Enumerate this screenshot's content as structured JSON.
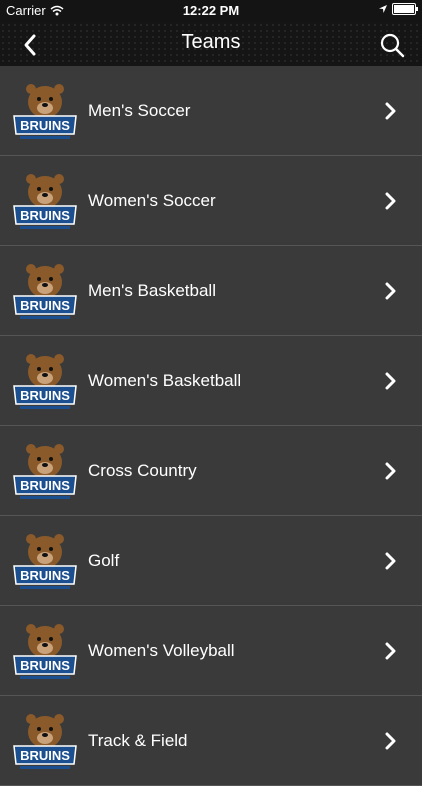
{
  "status_bar": {
    "carrier": "Carrier",
    "time": "12:22 PM"
  },
  "nav": {
    "title": "Teams",
    "back_icon": "back-chevron-icon",
    "search_icon": "search-icon"
  },
  "teams": [
    {
      "label": "Men's Soccer",
      "logo_text": "BRUINS"
    },
    {
      "label": "Women's Soccer",
      "logo_text": "BRUINS"
    },
    {
      "label": "Men's Basketball",
      "logo_text": "BRUINS"
    },
    {
      "label": "Women's Basketball",
      "logo_text": "BRUINS"
    },
    {
      "label": "Cross Country",
      "logo_text": "BRUINS"
    },
    {
      "label": "Golf",
      "logo_text": "BRUINS"
    },
    {
      "label": "Women's Volleyball",
      "logo_text": "BRUINS"
    },
    {
      "label": "Track & Field",
      "logo_text": "BRUINS"
    }
  ],
  "colors": {
    "background": "#3a3a3a",
    "nav": "#151515",
    "logo_blue": "#1b4f8f",
    "logo_brown": "#8a5a2b"
  }
}
